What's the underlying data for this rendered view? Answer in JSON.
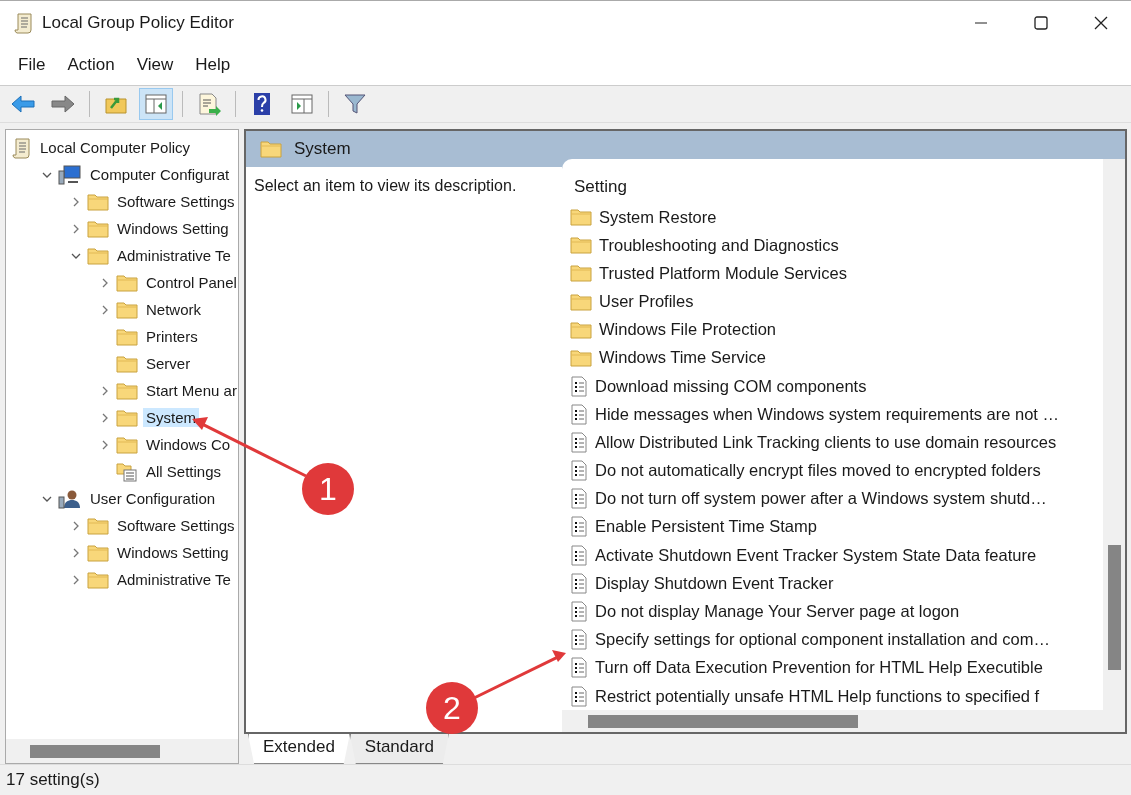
{
  "window": {
    "title": "Local Group Policy Editor"
  },
  "menu": [
    "File",
    "Action",
    "View",
    "Help"
  ],
  "toolbar": [
    {
      "kind": "back",
      "selected": false
    },
    {
      "kind": "forward",
      "selected": false
    },
    {
      "kind": "up",
      "selected": false
    },
    {
      "kind": "tree",
      "selected": true
    },
    {
      "kind": "export",
      "selected": false
    },
    {
      "kind": "help",
      "selected": false
    },
    {
      "kind": "pane",
      "selected": false
    },
    {
      "kind": "filter",
      "selected": false
    }
  ],
  "tree": {
    "label": "Local Computer Policy",
    "kind": "policy",
    "selected": false,
    "children": [
      {
        "label": "Computer Configurat",
        "kind": "computer",
        "expandable": true,
        "expanded": true,
        "selected": false,
        "children": [
          {
            "label": "Software Settings",
            "kind": "folder",
            "expandable": true,
            "expanded": false,
            "selected": false
          },
          {
            "label": "Windows Setting",
            "kind": "folder",
            "expandable": true,
            "expanded": false,
            "selected": false
          },
          {
            "label": "Administrative Te",
            "kind": "folder",
            "expandable": true,
            "expanded": true,
            "selected": false,
            "children": [
              {
                "label": "Control Panel",
                "kind": "folder",
                "expandable": true,
                "expanded": false,
                "selected": false
              },
              {
                "label": "Network",
                "kind": "folder",
                "expandable": true,
                "expanded": false,
                "selected": false
              },
              {
                "label": "Printers",
                "kind": "folder",
                "expandable": false,
                "expanded": false,
                "selected": false
              },
              {
                "label": "Server",
                "kind": "folder",
                "expandable": false,
                "expanded": false,
                "selected": false
              },
              {
                "label": "Start Menu ar",
                "kind": "folder",
                "expandable": true,
                "expanded": false,
                "selected": false
              },
              {
                "label": "System",
                "kind": "folder",
                "expandable": true,
                "expanded": false,
                "selected": true
              },
              {
                "label": "Windows Co",
                "kind": "folder",
                "expandable": true,
                "expanded": false,
                "selected": false
              },
              {
                "label": "All Settings",
                "kind": "all",
                "expandable": false,
                "expanded": false,
                "selected": false
              }
            ]
          }
        ]
      },
      {
        "label": "User Configuration",
        "kind": "user",
        "expandable": true,
        "expanded": true,
        "selected": false,
        "children": [
          {
            "label": "Software Settings",
            "kind": "folder",
            "expandable": true,
            "expanded": false,
            "selected": false
          },
          {
            "label": "Windows Setting",
            "kind": "folder",
            "expandable": true,
            "expanded": false,
            "selected": false
          },
          {
            "label": "Administrative Te",
            "kind": "folder",
            "expandable": true,
            "expanded": false,
            "selected": false
          }
        ]
      }
    ]
  },
  "details": {
    "heading": "System",
    "description": "Select an item to view its description.",
    "column": "Setting",
    "rows": [
      {
        "kind": "folder",
        "label": "System Restore"
      },
      {
        "kind": "folder",
        "label": "Troubleshooting and Diagnostics"
      },
      {
        "kind": "folder",
        "label": "Trusted Platform Module Services"
      },
      {
        "kind": "folder",
        "label": "User Profiles"
      },
      {
        "kind": "folder",
        "label": "Windows File Protection"
      },
      {
        "kind": "folder",
        "label": "Windows Time Service"
      },
      {
        "kind": "policy",
        "label": "Download missing COM components"
      },
      {
        "kind": "policy",
        "label": "Hide messages when Windows system requirements are not …"
      },
      {
        "kind": "policy",
        "label": "Allow Distributed Link Tracking clients to use domain resources"
      },
      {
        "kind": "policy",
        "label": "Do not automatically encrypt files moved to encrypted folders"
      },
      {
        "kind": "policy",
        "label": "Do not turn off system power after a Windows system shutd…"
      },
      {
        "kind": "policy",
        "label": "Enable Persistent Time Stamp"
      },
      {
        "kind": "policy",
        "label": "Activate Shutdown Event Tracker System State Data feature"
      },
      {
        "kind": "policy",
        "label": "Display Shutdown Event Tracker"
      },
      {
        "kind": "policy",
        "label": "Do not display Manage Your Server page at logon"
      },
      {
        "kind": "policy",
        "label": "Specify settings for optional component installation and com…"
      },
      {
        "kind": "policy",
        "label": "Turn off Data Execution Prevention for HTML Help Executible"
      },
      {
        "kind": "policy",
        "label": "Restrict potentially unsafe HTML Help functions to specified f"
      }
    ]
  },
  "tabs": [
    {
      "label": "Extended",
      "selected": true
    },
    {
      "label": "Standard",
      "selected": false
    }
  ],
  "status_bar": "17 setting(s)",
  "annotations": [
    {
      "number": "1"
    },
    {
      "number": "2"
    }
  ]
}
